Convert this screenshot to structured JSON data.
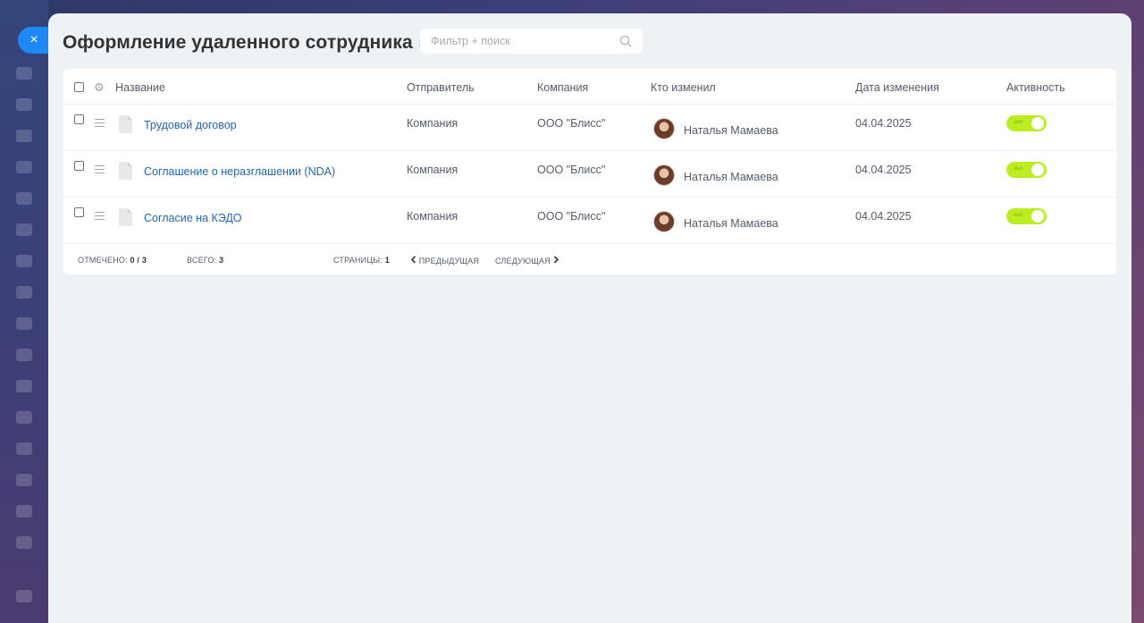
{
  "close_label": "×",
  "title": "Оформление удаленного сотрудника",
  "search": {
    "placeholder": "Фильтр + поиск"
  },
  "columns": {
    "name": "Название",
    "sender": "Отправитель",
    "company": "Компания",
    "modified_by": "Кто изменил",
    "modified_date": "Дата изменения",
    "active": "Активность"
  },
  "rows": [
    {
      "name": "Трудовой договор",
      "sender": "Компания",
      "company": "ООО \"Блисс\"",
      "modified_by": "Наталья Мамаева",
      "date": "04.04.2025",
      "toggle": "вкл",
      "active": true
    },
    {
      "name": "Соглашение о неразглашении (NDA)",
      "sender": "Компания",
      "company": "ООО \"Блисс\"",
      "modified_by": "Наталья Мамаева",
      "date": "04.04.2025",
      "toggle": "вкл",
      "active": true
    },
    {
      "name": "Согласие на КЭДО",
      "sender": "Компания",
      "company": "ООО \"Блисс\"",
      "modified_by": "Наталья Мамаева",
      "date": "04.04.2025",
      "toggle": "вкл",
      "active": true
    }
  ],
  "footer": {
    "selected_label": "Отмечено:",
    "selected_value": "0 / 3",
    "total_label": "Всего:",
    "total_value": "3",
    "pages_label": "Страницы:",
    "pages_value": "1",
    "prev": "Предыдущая",
    "next": "Следующая"
  },
  "colors": {
    "accent": "#1e88f5",
    "link": "#2067b0",
    "toggle_on": "#bbed21"
  },
  "icons": [
    "close-icon",
    "pin-icon",
    "search-icon",
    "gear-icon",
    "drag-handle-icon",
    "document-icon",
    "chevron-left-icon",
    "chevron-right-icon"
  ]
}
